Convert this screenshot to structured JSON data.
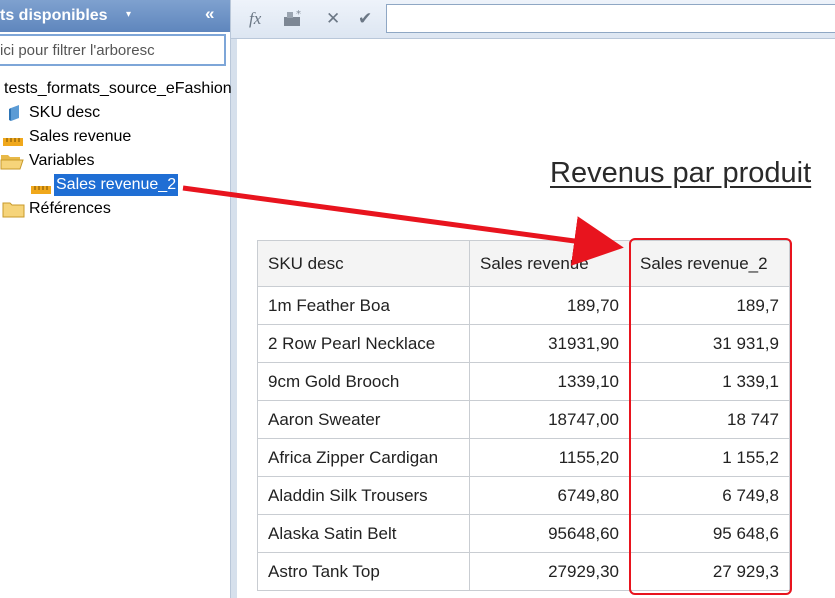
{
  "left_panel": {
    "title": "ts disponibles",
    "caret": "▾",
    "collapse": "«",
    "filter_placeholder": "ez ici pour filtrer l'arboresc",
    "tree": {
      "root": "tests_formats_source_eFashion",
      "items": [
        {
          "label": "SKU desc",
          "icon": "dimension-icon"
        },
        {
          "label": "Sales revenue",
          "icon": "measure-icon"
        },
        {
          "label": "Variables",
          "icon": "folder-open-icon"
        },
        {
          "label": "Sales revenue_2",
          "icon": "measure-icon",
          "selected": true
        },
        {
          "label": "Références",
          "icon": "folder-icon"
        }
      ]
    }
  },
  "toolbar": {
    "formula_icon": "fx",
    "check_icon": "✔",
    "cancel_icon": "✕"
  },
  "report": {
    "title": "Revenus par produit",
    "table": {
      "headers": [
        "SKU desc",
        "Sales revenue",
        "Sales revenue_2"
      ],
      "rows": [
        [
          "1m Feather Boa",
          "189,70",
          "189,7"
        ],
        [
          "2 Row Pearl Necklace",
          "31931,90",
          "31 931,9"
        ],
        [
          "9cm Gold Brooch",
          "1339,10",
          "1 339,1"
        ],
        [
          "Aaron Sweater",
          "18747,00",
          "18 747"
        ],
        [
          "Africa Zipper Cardigan",
          "1155,20",
          "1 155,2"
        ],
        [
          "Aladdin Silk Trousers",
          "6749,80",
          "6 749,8"
        ],
        [
          "Alaska Satin Belt",
          "95648,60",
          "95 648,6"
        ],
        [
          "Astro Tank Top",
          "27929,30",
          "27 929,3"
        ]
      ]
    }
  },
  "colors": {
    "annotation": "#e8141e",
    "selection": "#1f6ed4",
    "header_blue": "#6a8fc6"
  }
}
